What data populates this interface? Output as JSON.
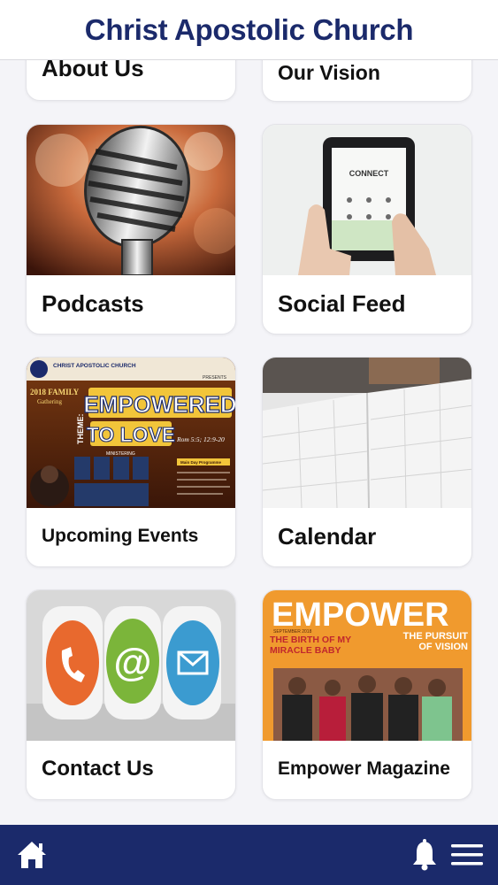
{
  "header": {
    "title": "Christ Apostolic Church"
  },
  "tiles": {
    "about": {
      "label": "About Us"
    },
    "vision": {
      "label": "Our Vision"
    },
    "podcasts": {
      "label": "Podcasts"
    },
    "social": {
      "label": "Social Feed",
      "tablet_text": "CONNECT"
    },
    "events": {
      "label": "Upcoming Events",
      "poster": {
        "org": "CHRIST APOSTOLIC CHURCH",
        "presents": "PRESENTS",
        "year_line": "2018 FAMILY",
        "gathering": "Gathering",
        "theme": "THEME:",
        "line1": "EMPOWERED",
        "line2": "TO LOVE",
        "verse": "Rom 5:5; 12:9-20",
        "ministering": "MINISTERING",
        "programme": "Main Day Programme"
      }
    },
    "calendar": {
      "label": "Calendar"
    },
    "contact": {
      "label": "Contact Us"
    },
    "magazine": {
      "label": "Empower Magazine",
      "cover": {
        "masthead": "EMPOWER",
        "issue": "SEPTEMBER 2018",
        "headline_left": "THE BIRTH OF MY MIRACLE BABY",
        "headline_right": "THE PURSUIT OF VISION"
      }
    }
  },
  "colors": {
    "brand": "#1b2a6b",
    "card_bg": "#ffffff",
    "page_bg": "#f4f4f8"
  },
  "icons": {
    "home": "home-icon",
    "bell": "bell-icon",
    "menu": "menu-icon"
  }
}
